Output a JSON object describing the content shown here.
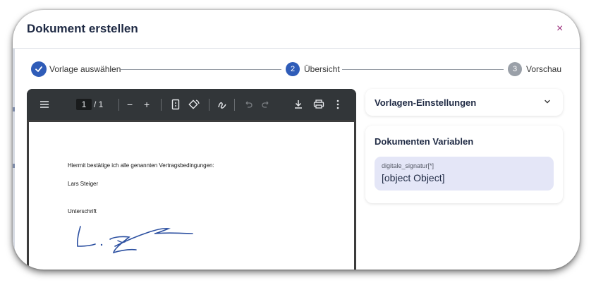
{
  "dialog": {
    "title": "Dokument erstellen",
    "close_label": "×"
  },
  "stepper": {
    "steps": [
      {
        "label": "Vorlage auswählen",
        "state": "done",
        "number": ""
      },
      {
        "label": "Übersicht",
        "state": "active",
        "number": "2"
      },
      {
        "label": "Vorschau",
        "state": "pending",
        "number": "3"
      }
    ]
  },
  "pdf_toolbar": {
    "page_current": "1",
    "page_total": "/ 1",
    "zoom_out": "−",
    "zoom_in": "+"
  },
  "document": {
    "line1": "Hiermit bestätige ich alle genannten Vertragsbedingungen:",
    "line2": "Lars Steiger",
    "line3": "Unterschrift"
  },
  "settings_panel": {
    "label": "Vorlagen-Einstellungen"
  },
  "variables_panel": {
    "label": "Dokumenten Variablen",
    "variable": {
      "name": "digitale_signatur[*]",
      "value": "[object Object]"
    }
  },
  "colors": {
    "accent": "#2f5cb8",
    "pending": "#9aa0a8",
    "close": "#9b2f7c",
    "variable_bg": "#e4e6f7",
    "signature": "#2b4fa0"
  },
  "icons": {
    "menu": "menu-icon",
    "fit_page": "fit-page-icon",
    "rotate": "rotate-icon",
    "annotate": "annotate-icon",
    "undo": "undo-icon",
    "redo": "redo-icon",
    "download": "download-icon",
    "print": "print-icon",
    "more": "more-vertical-icon",
    "chevron": "chevron-down-icon",
    "check": "check-icon"
  }
}
